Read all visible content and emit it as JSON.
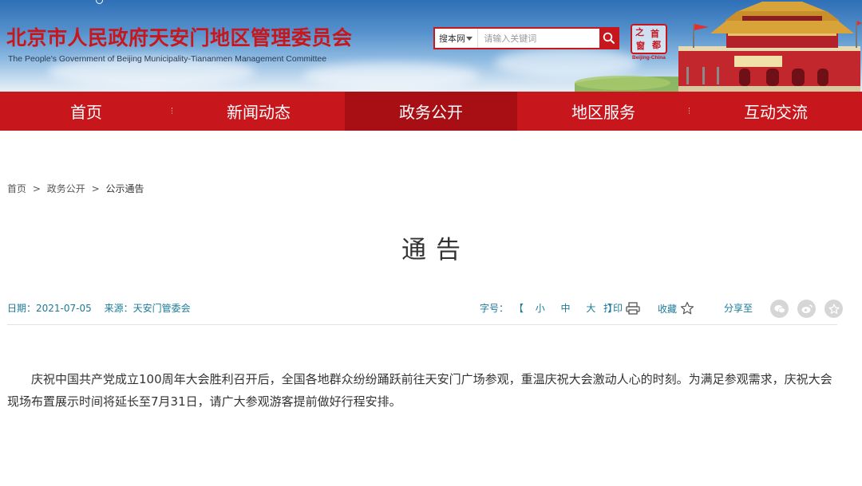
{
  "header": {
    "site_title": "北京市人民政府天安门地区管理委员会",
    "site_subtitle": "The People's Government of Beijing Municipality-Tiananmen Management Committee",
    "search": {
      "scope": "搜本网",
      "placeholder": "请输入关键词"
    },
    "seal": {
      "chars": [
        "之",
        "首",
        "都",
        "窗"
      ],
      "caption": "Beijing-China"
    },
    "colors": {
      "brand_red": "#c8161d",
      "nav_active": "#a80f15",
      "meta_text": "#1b7a98"
    }
  },
  "nav": {
    "items": [
      {
        "label": "首页"
      },
      {
        "label": "新闻动态"
      },
      {
        "label": "政务公开",
        "active": true
      },
      {
        "label": "地区服务"
      },
      {
        "label": "互动交流"
      }
    ]
  },
  "breadcrumb": {
    "home": "首页",
    "section": "政务公开",
    "current": "公示通告",
    "separator": ">"
  },
  "article": {
    "title": "通告",
    "date_label": "日期：",
    "date": "2021-07-05",
    "source_label": "来源：",
    "source": "天安门管委会",
    "font_size_label": "字号：",
    "font_sizes": [
      "小",
      "中",
      "大"
    ],
    "bracket_open": "【",
    "bracket_close": "】",
    "print_label": "打印",
    "favorite_label": "收藏",
    "share_label": "分享至",
    "share_icons": [
      "wechat-icon",
      "weibo-icon",
      "star-icon"
    ],
    "body": "庆祝中国共产党成立100周年大会胜利召开后，全国各地群众纷纷踊跃前往天安门广场参观，重温庆祝大会激动人心的时刻。为满足参观需求，庆祝大会现场布置展示时间将延长至7月31日，请广大参观游客提前做好行程安排。"
  }
}
